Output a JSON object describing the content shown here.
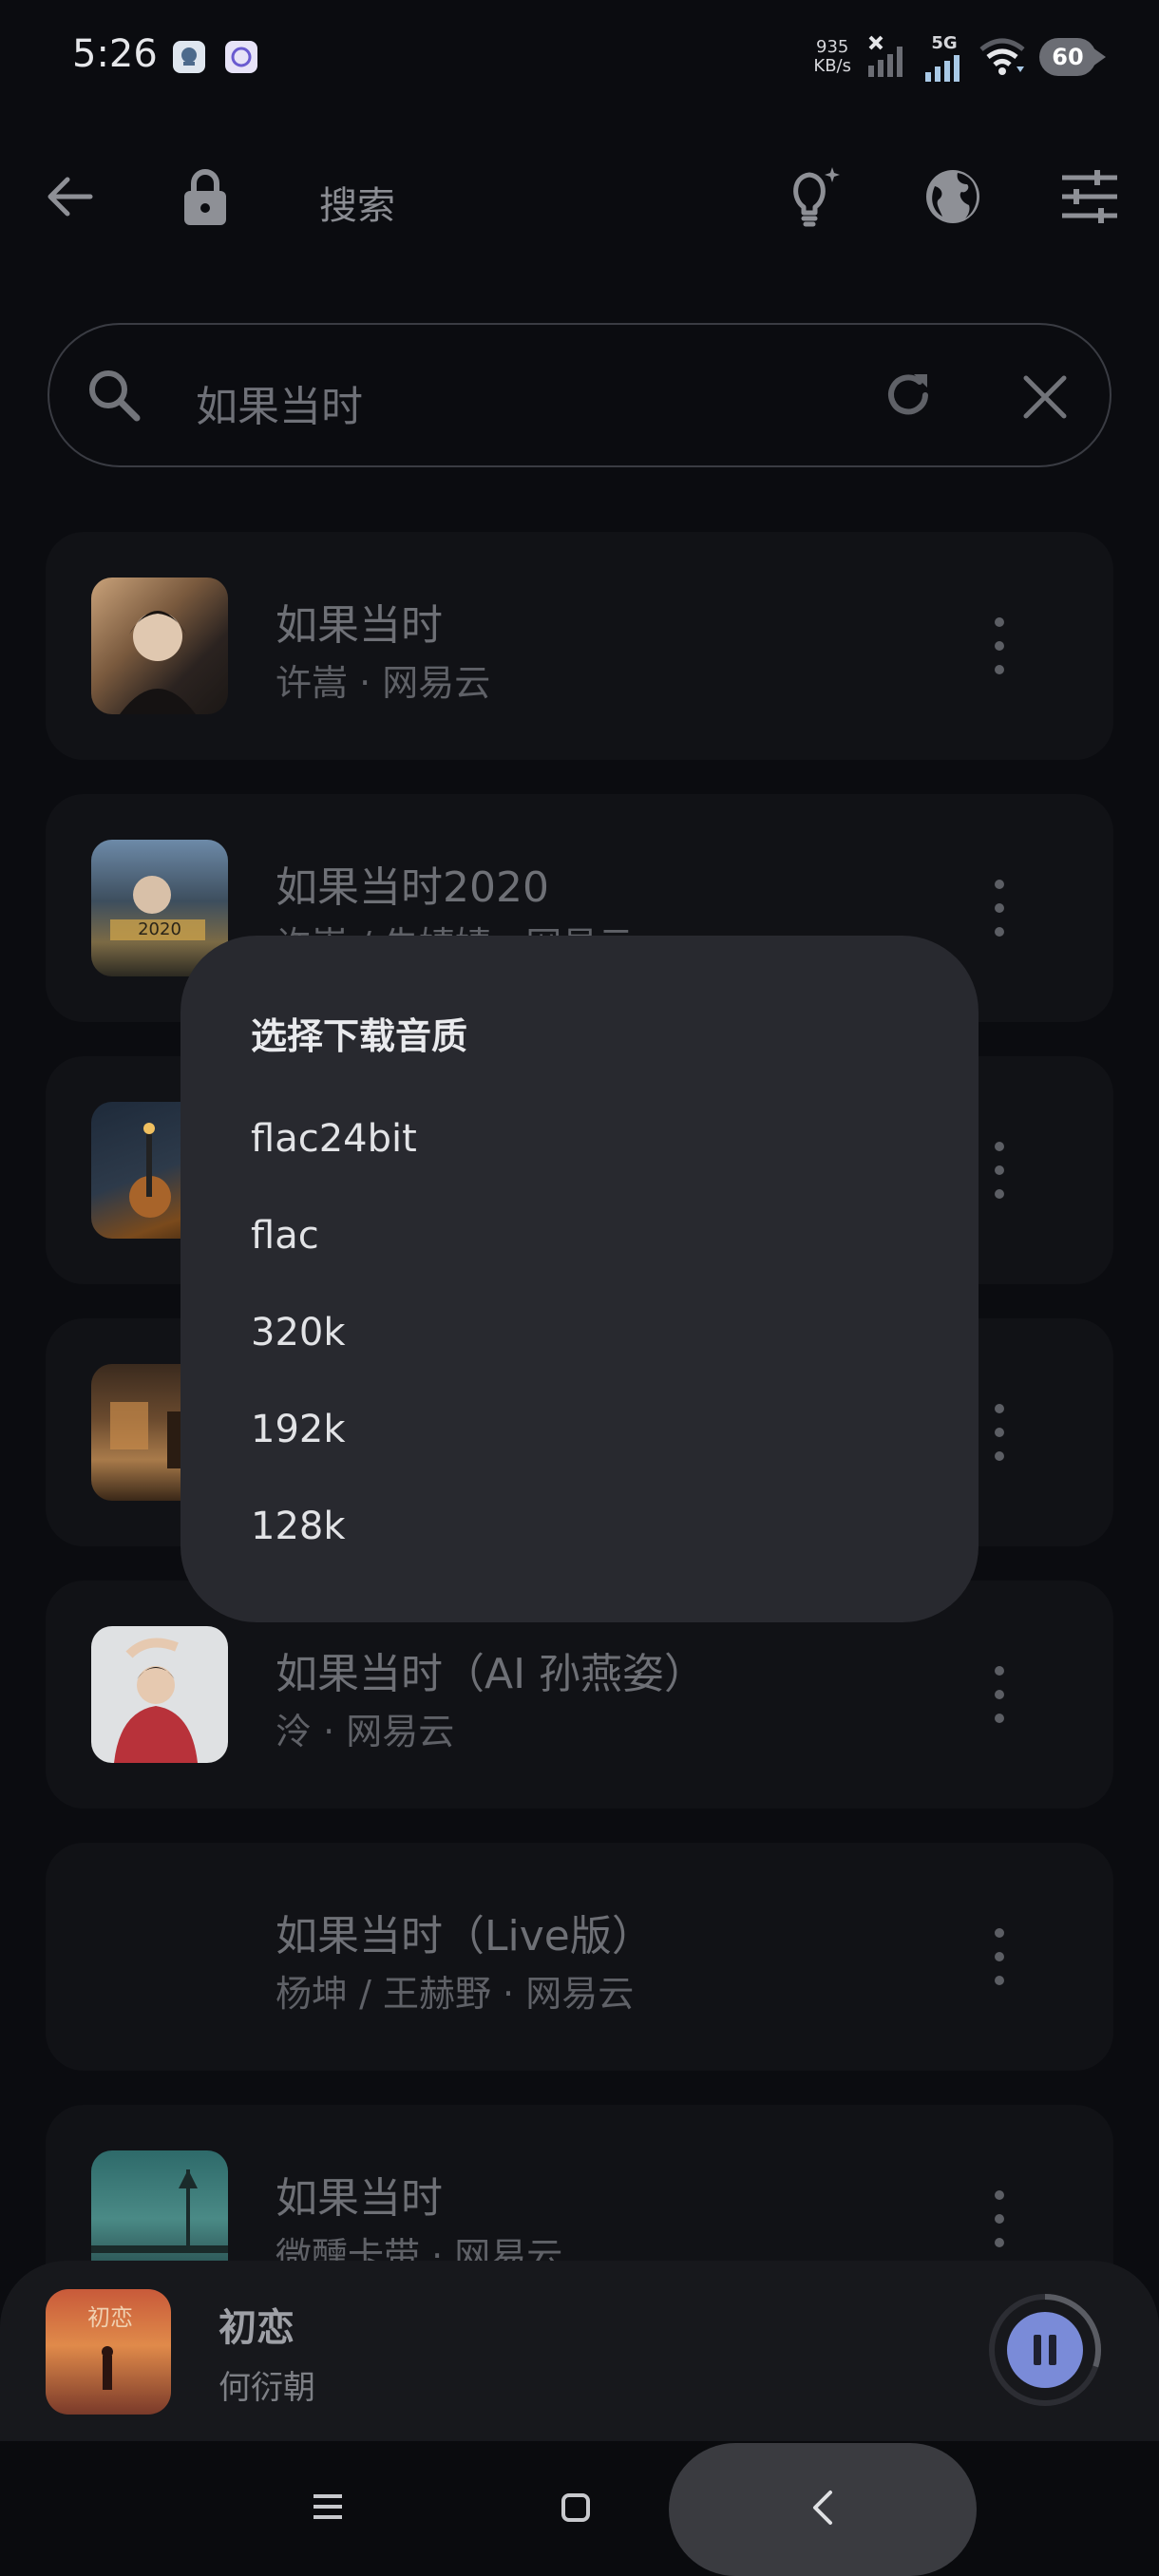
{
  "status_bar": {
    "time": "5:26",
    "net_speed_value": "935",
    "net_speed_unit": "KB/s",
    "network": "5G",
    "battery": "60"
  },
  "toolbar": {
    "title": "搜索"
  },
  "search": {
    "query": "如果当时"
  },
  "results": [
    {
      "title": "如果当时",
      "subtitle": "许嵩 · 网易云"
    },
    {
      "title": "如果当时2020",
      "subtitle": "许嵩 / 朱婧婧 · 网易云"
    },
    {
      "title": "",
      "subtitle": ""
    },
    {
      "title": "",
      "subtitle": ""
    },
    {
      "title": "如果当时（AI 孙燕姿）",
      "subtitle": "泠 · 网易云"
    },
    {
      "title": "如果当时（Live版）",
      "subtitle": "杨坤 / 王赫野 · 网易云"
    },
    {
      "title": "如果当时",
      "subtitle": "微醺卡带 · 网易云"
    }
  ],
  "dialog": {
    "title": "选择下载音质",
    "options": [
      "flac24bit",
      "flac",
      "320k",
      "192k",
      "128k"
    ]
  },
  "player": {
    "title": "初恋",
    "artist": "何衍朝",
    "cover_text": "初恋",
    "progress": 0.3
  },
  "colors": {
    "background": "#0b0c10",
    "dialog": "#28292f",
    "accent": "#7a8bd8"
  }
}
